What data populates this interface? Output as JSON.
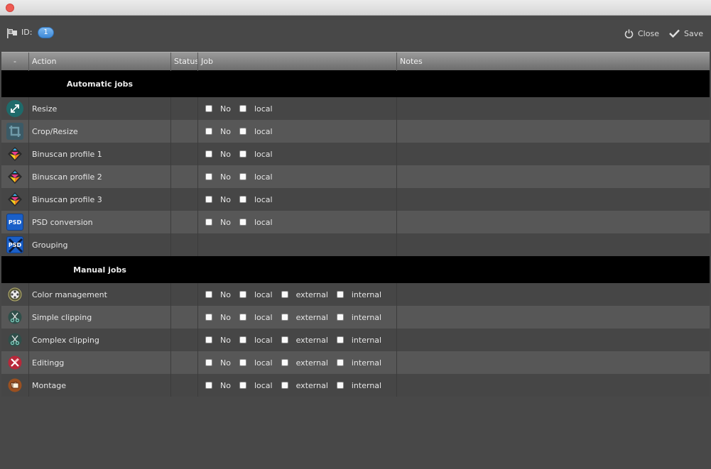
{
  "toolbar": {
    "id_label": "ID:",
    "id_value": "1",
    "close_label": "Close",
    "save_label": "Save"
  },
  "table": {
    "headers": [
      "-",
      "Action",
      "Status",
      "Job",
      "Notes"
    ]
  },
  "sections": {
    "automatic": {
      "title": "Automatic jobs",
      "rows": [
        {
          "label": "Resize",
          "icon": "resize-icon",
          "options": [
            "No",
            "local"
          ]
        },
        {
          "label": "Crop/Resize",
          "icon": "crop-icon",
          "options": [
            "No",
            "local"
          ]
        },
        {
          "label": "Binuscan profile 1",
          "icon": "binuscan-profile-icon",
          "options": [
            "No",
            "local"
          ]
        },
        {
          "label": "Binuscan profile 2",
          "icon": "binuscan-profile-icon",
          "options": [
            "No",
            "local"
          ]
        },
        {
          "label": "Binuscan profile 3",
          "icon": "binuscan-profile-icon",
          "options": [
            "No",
            "local"
          ]
        },
        {
          "label": "PSD conversion",
          "icon": "psd-icon",
          "options": [
            "No",
            "local"
          ]
        },
        {
          "label": "Grouping",
          "icon": "psd-grouping-icon",
          "options": []
        }
      ]
    },
    "manual": {
      "title": "Manual jobs",
      "rows": [
        {
          "label": "Color management",
          "icon": "color-management-icon",
          "options": [
            "No",
            "local",
            "external",
            "internal"
          ]
        },
        {
          "label": "Simple clipping",
          "icon": "scissors-icon",
          "options": [
            "No",
            "local",
            "external",
            "internal"
          ]
        },
        {
          "label": "Complex clipping",
          "icon": "scissors-icon",
          "options": [
            "No",
            "local",
            "external",
            "internal"
          ]
        },
        {
          "label": "Editingg",
          "icon": "editing-icon",
          "options": [
            "No",
            "local",
            "external",
            "internal"
          ]
        },
        {
          "label": "Montage",
          "icon": "montage-icon",
          "options": [
            "No",
            "local",
            "external",
            "internal"
          ]
        }
      ]
    }
  },
  "colors": {
    "background": "#484848",
    "accent": "#3f8ad8",
    "section_bg": "#000000"
  }
}
